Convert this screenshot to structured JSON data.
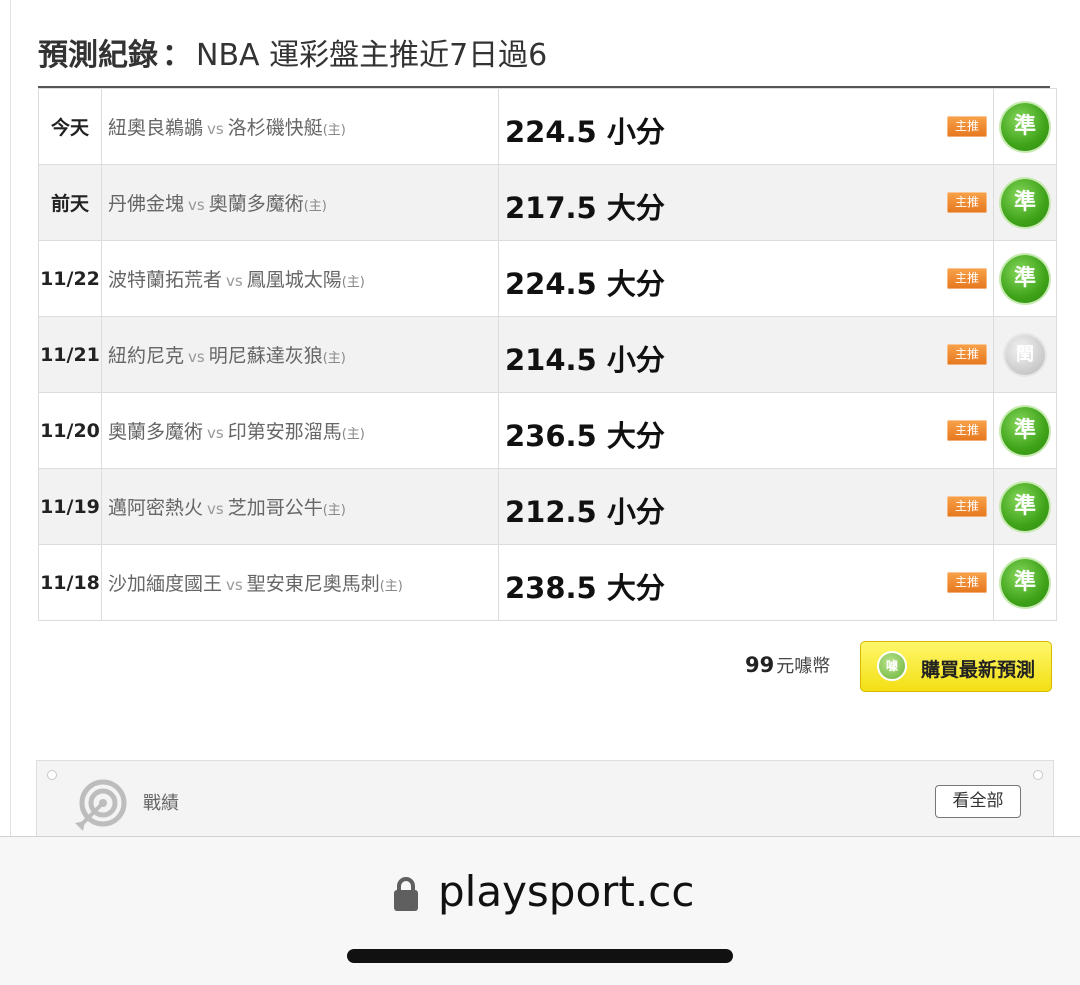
{
  "header": {
    "label": "預測紀錄",
    "separator": "：",
    "subtitle": "NBA 運彩盤主推近7日過6"
  },
  "records": [
    {
      "date": "今天",
      "away": "紐奧良鵜鶘",
      "vs": "vs",
      "home": "洛杉磯快艇",
      "home_mark": "(主)",
      "pick": "224.5 小分",
      "badge": "主推",
      "result": "準",
      "result_type": "hit"
    },
    {
      "date": "前天",
      "away": "丹佛金塊",
      "vs": "vs",
      "home": "奧蘭多魔術",
      "home_mark": "(主)",
      "pick": "217.5 大分",
      "badge": "主推",
      "result": "準",
      "result_type": "hit"
    },
    {
      "date": "11/22",
      "away": "波特蘭拓荒者",
      "vs": "vs",
      "home": "鳳凰城太陽",
      "home_mark": "(主)",
      "pick": "224.5 大分",
      "badge": "主推",
      "result": "準",
      "result_type": "hit"
    },
    {
      "date": "11/21",
      "away": "紐約尼克",
      "vs": "vs",
      "home": "明尼蘇達灰狼",
      "home_mark": "(主)",
      "pick": "214.5 小分",
      "badge": "主推",
      "result": "閏",
      "result_type": "push"
    },
    {
      "date": "11/20",
      "away": "奧蘭多魔術",
      "vs": "vs",
      "home": "印第安那溜馬",
      "home_mark": "(主)",
      "pick": "236.5 大分",
      "badge": "主推",
      "result": "準",
      "result_type": "hit"
    },
    {
      "date": "11/19",
      "away": "邁阿密熱火",
      "vs": "vs",
      "home": "芝加哥公牛",
      "home_mark": "(主)",
      "pick": "212.5 小分",
      "badge": "主推",
      "result": "準",
      "result_type": "hit"
    },
    {
      "date": "11/18",
      "away": "沙加緬度國王",
      "vs": "vs",
      "home": "聖安東尼奧馬刺",
      "home_mark": "(主)",
      "pick": "238.5 大分",
      "badge": "主推",
      "result": "準",
      "result_type": "hit"
    }
  ],
  "purchase": {
    "price": "99",
    "unit": "元噱幣",
    "icon_text": "噱",
    "button_label": "購買最新預測"
  },
  "record_panel": {
    "title": "戰績",
    "view_all": "看全部",
    "icon": "target-icon"
  },
  "browser": {
    "url": "playsport.cc",
    "icon": "lock-icon"
  },
  "colors": {
    "hit": "#3fa319",
    "push": "#c9c9c9",
    "badge": "#e6771e",
    "buy_button": "#f3df14"
  }
}
